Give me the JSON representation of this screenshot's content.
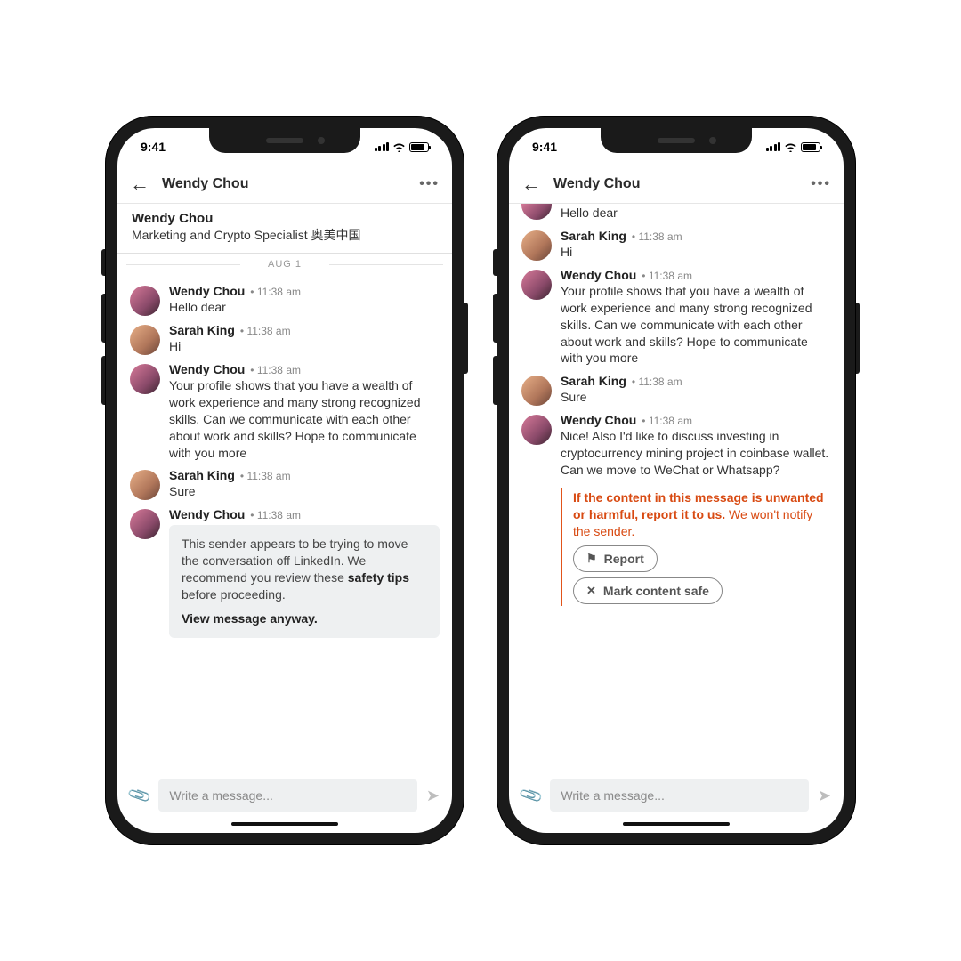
{
  "status": {
    "time": "9:41"
  },
  "header": {
    "title": "Wendy Chou",
    "back_label": "Back",
    "more_label": "More"
  },
  "profile": {
    "name": "Wendy Chou",
    "subtitle": "Marketing and Crypto Specialist 奥美中国"
  },
  "date_separator": "AUG 1",
  "composer": {
    "placeholder": "Write a message..."
  },
  "people": {
    "wendy": "Wendy Chou",
    "sarah": "Sarah King"
  },
  "times": {
    "t": "11:38 am"
  },
  "messages": {
    "hello": "Hello dear",
    "hi": "Hi",
    "pitch": "Your profile shows that you have a wealth of work experience and many strong recognized skills. Can we communicate with each other about work and skills? Hope to communicate with you more",
    "sure": "Sure",
    "crypto": "Nice! Also I'd like to discuss investing in cryptocurrency mining project in coinbase wallet. Can we move to WeChat or Whatsapp?"
  },
  "hidden_card": {
    "line1": "This sender appears to be trying to move the conversation off LinkedIn. We recommend you review these ",
    "bold": "safety tips",
    "line2": " before proceeding.",
    "cta": "View message anyway."
  },
  "warning": {
    "text1": "If the content in this message is unwanted or harmful, report it to us.",
    "text2": "We won't notify the sender.",
    "report_label": "Report",
    "safe_label": "Mark content safe"
  }
}
